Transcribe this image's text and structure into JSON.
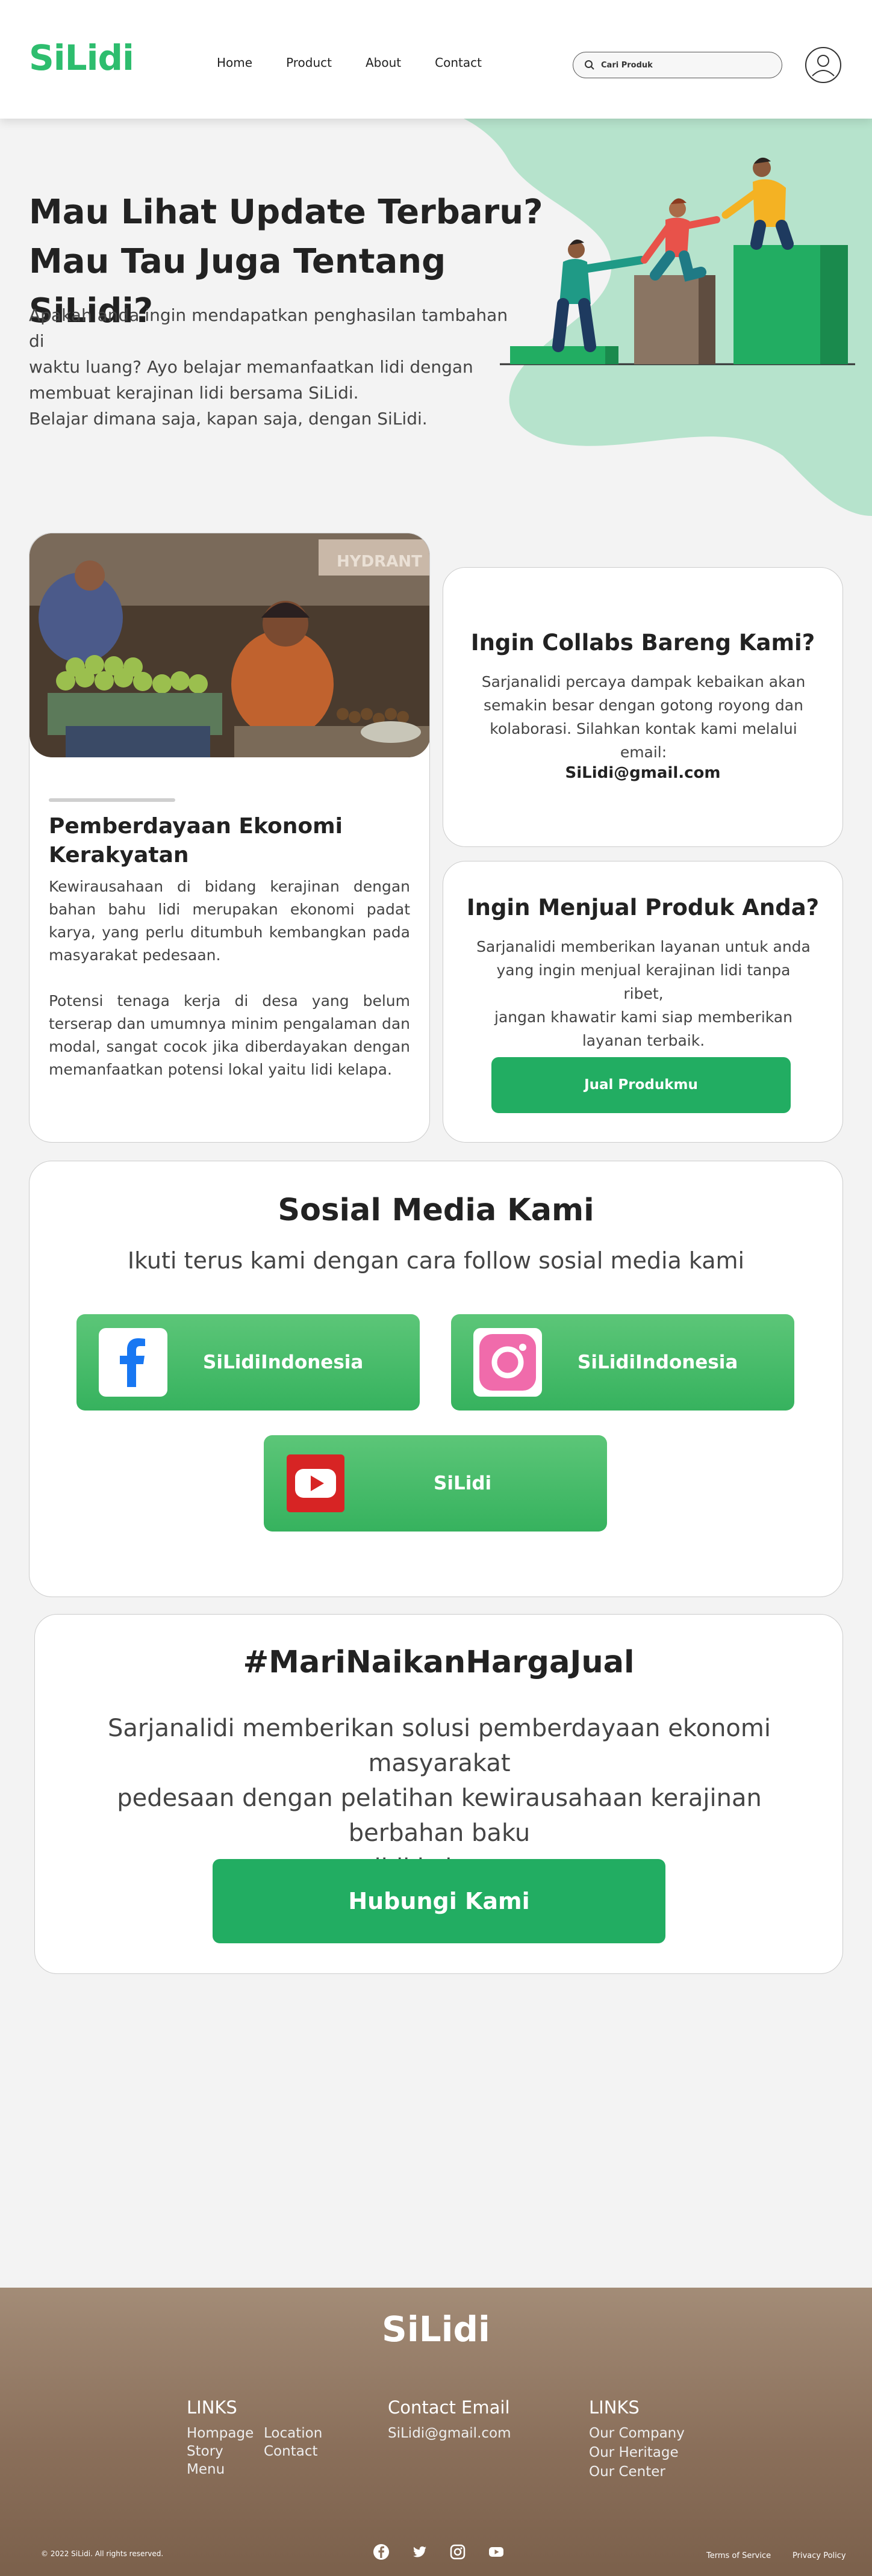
{
  "nav": {
    "logo": "SiLidi",
    "links": [
      "Home",
      "Product",
      "About",
      "Contact"
    ],
    "search_placeholder": "Cari Produk",
    "icons": {
      "search": "search-icon",
      "avatar": "user-icon"
    }
  },
  "hero": {
    "title_line1": "Mau Lihat Update Terbaru?",
    "title_line2": "Mau Tau Juga Tentang SiLidi?",
    "desc_line1": "Apakah anda ingin mendapatkan penghasilan tambahan di",
    "desc_line2": "waktu luang? Ayo belajar memanfaatkan lidi dengan",
    "desc_line3": "membuat kerajinan lidi bersama SiLidi.",
    "desc_line4": "Belajar dimana saja, kapan saja, dengan SiLidi.",
    "illustration": "teamwork-climbing-illustration"
  },
  "photo_card": {
    "title_line1": "Pemberdayaan Ekonomi",
    "title_line2": "Kerakyatan",
    "paragraph1": "Kewirausahaan di bidang kerajinan dengan bahan bahu lidi merupakan ekonomi padat karya, yang perlu ditumbuh kembangkan pada masyarakat pedesaan.",
    "paragraph2": "Potensi tenaga kerja di desa yang belum terserap dan umumnya minim pengalaman dan modal, sangat cocok jika diberdayakan dengan memanfaatkan potensi lokal yaitu lidi kelapa.",
    "photo_sign": "HYDRANT",
    "photo": "market-vendor-photo"
  },
  "collab_card": {
    "title": "Ingin Collabs Bareng Kami?",
    "text_line1": "Sarjanalidi percaya dampak kebaikan akan",
    "text_line2": "semakin besar dengan gotong royong dan",
    "text_line3": "kolaborasi. Silahkan kontak kami melalui",
    "text_line4": "email:",
    "email": "SiLidi@gmail.com"
  },
  "sell_card": {
    "title": "Ingin Menjual Produk Anda?",
    "text_line1": "Sarjanalidi memberikan layanan untuk anda",
    "text_line2": "yang ingin menjual kerajinan lidi tanpa ribet,",
    "text_line3": "jangan khawatir kami siap memberikan",
    "text_line4": "layanan terbaik.",
    "button": "Jual Produkmu"
  },
  "social": {
    "title": "Sosial Media Kami",
    "subtitle": "Ikuti terus kami dengan cara follow sosial media kami",
    "facebook": "SiLidiIndonesia",
    "instagram": "SiLidiIndonesia",
    "youtube": "SiLidi"
  },
  "cta": {
    "title": "#MariNaikanHargaJual",
    "text_line1": "Sarjanalidi memberikan solusi pemberdayaan ekonomi masyarakat",
    "text_line2": "pedesaan dengan pelatihan kewirausahaan kerajinan berbahan baku",
    "text_line3": "lidi kelapa.",
    "button": "Hubungi Kami"
  },
  "footer": {
    "logo": "SiLidi",
    "col1_title": "LINKS",
    "col1_a": [
      "Hompage",
      "Story",
      "Menu"
    ],
    "col1_b": [
      "Location",
      "Contact"
    ],
    "col2_title": "Contact Email",
    "col2_email": "SiLidi@gmail.com",
    "col3_title": "LINKS",
    "col3_links": [
      "Our Company",
      "Our Heritage",
      "Our Center"
    ],
    "copyright": "© 2022 SiLidi. All rights reserved.",
    "terms": "Terms of Service",
    "privacy": "Privacy Policy",
    "social_icons": [
      "facebook-icon",
      "twitter-icon",
      "instagram-icon",
      "youtube-icon"
    ]
  },
  "colors": {
    "brand_green": "#2ebd6e",
    "button_green": "#22ad62",
    "hero_blob": "#b6e3cc",
    "footer_brown": "#8a6f5a"
  }
}
